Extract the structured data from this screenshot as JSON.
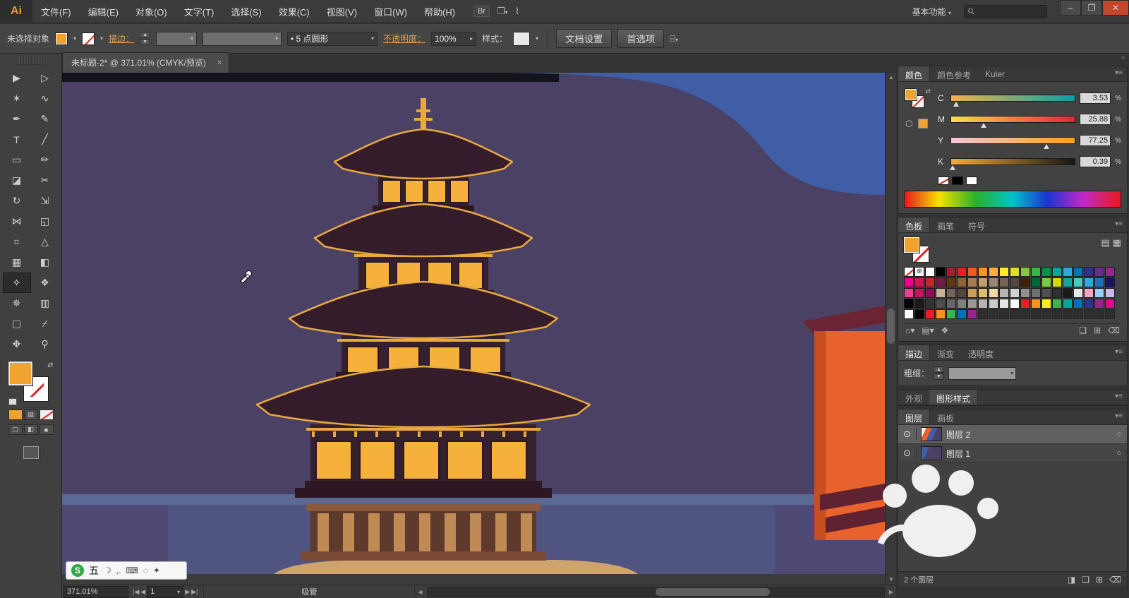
{
  "menubar": {
    "logo": "Ai",
    "items": [
      "文件(F)",
      "编辑(E)",
      "对象(O)",
      "文字(T)",
      "选择(S)",
      "效果(C)",
      "视图(V)",
      "窗口(W)",
      "帮助(H)"
    ],
    "bridge_label": "Br",
    "workspace_label": "基本功能",
    "workspace_arrow": "▾",
    "window_buttons": {
      "minimize": "–",
      "restore": "❐",
      "close": "✕"
    }
  },
  "control_bar": {
    "no_selection": "未选择对象",
    "stroke_label": "描边：",
    "brush_bullet": "•",
    "brush_value": "5 点圆形",
    "opacity_label": "不透明度：",
    "opacity_value": "100%",
    "style_label": "样式：",
    "doc_setup_label": "文档设置",
    "preferences_label": "首选项"
  },
  "document": {
    "tab_title": "未标题-2* @ 371.01% (CMYK/预览)",
    "close_glyph": "×"
  },
  "toolbar": {
    "tools": [
      {
        "name": "selection-tool",
        "glyph": "▶"
      },
      {
        "name": "direct-selection-tool",
        "glyph": "▷"
      },
      {
        "name": "magic-wand-tool",
        "glyph": "✶"
      },
      {
        "name": "lasso-tool",
        "glyph": "∿"
      },
      {
        "name": "pen-tool",
        "glyph": "✒"
      },
      {
        "name": "pencil-tool",
        "glyph": "✎"
      },
      {
        "name": "type-tool",
        "glyph": "T"
      },
      {
        "name": "line-segment-tool",
        "glyph": "╱"
      },
      {
        "name": "rectangle-tool",
        "glyph": "▭"
      },
      {
        "name": "paintbrush-tool",
        "glyph": "✏"
      },
      {
        "name": "eraser-tool",
        "glyph": "◪"
      },
      {
        "name": "scissors-tool",
        "glyph": "✂"
      },
      {
        "name": "rotate-tool",
        "glyph": "↻"
      },
      {
        "name": "scale-tool",
        "glyph": "⇲"
      },
      {
        "name": "width-tool",
        "glyph": "⋈"
      },
      {
        "name": "shape-builder-tool",
        "glyph": "◱"
      },
      {
        "name": "free-transform-tool",
        "glyph": "⌗"
      },
      {
        "name": "perspective-grid-tool",
        "glyph": "△"
      },
      {
        "name": "mesh-tool",
        "glyph": "▦"
      },
      {
        "name": "gradient-tool",
        "glyph": "◧"
      },
      {
        "name": "eyedropper-tool",
        "glyph": "✧",
        "active": true
      },
      {
        "name": "blend-tool",
        "glyph": "❖"
      },
      {
        "name": "symbol-sprayer-tool",
        "glyph": "✵"
      },
      {
        "name": "column-graph-tool",
        "glyph": "▥"
      },
      {
        "name": "artboard-tool",
        "glyph": "▢"
      },
      {
        "name": "slice-tool",
        "glyph": "⌿"
      },
      {
        "name": "hand-tool",
        "glyph": "✥"
      },
      {
        "name": "zoom-tool",
        "glyph": "⚲"
      }
    ]
  },
  "panels": {
    "color": {
      "tabs": [
        "颜色",
        "颜色参考",
        "Kuler"
      ],
      "channels": [
        {
          "label": "C",
          "value": "3.53",
          "pct": 4,
          "cls": "c"
        },
        {
          "label": "M",
          "value": "25.88",
          "pct": 26,
          "cls": "m"
        },
        {
          "label": "Y",
          "value": "77.25",
          "pct": 77,
          "cls": "y"
        },
        {
          "label": "K",
          "value": "0.39",
          "pct": 1,
          "cls": "k"
        }
      ],
      "percent_sign": "%"
    },
    "swatches": {
      "tabs": [
        "色板",
        "画笔",
        "符号"
      ],
      "grid": [
        [
          "none",
          "reg",
          "#ffffff",
          "#000000",
          "#9e1f2e",
          "#ed1c24",
          "#f15a24",
          "#f7931e",
          "#fbb03b",
          "#fcee21",
          "#d9e021",
          "#8cc63f",
          "#39b54a",
          "#009245",
          "#00a99d",
          "#29abe2",
          "#0071bc",
          "#2e3192",
          "#662d91",
          "#93278f"
        ],
        [
          "#ec008c",
          "#d4145a",
          "#c1272d",
          "#741b47",
          "#603813",
          "#8c6239",
          "#a67c52",
          "#c69c6d",
          "#998675",
          "#736357",
          "#534741",
          "#42210b",
          "#006837",
          "#7ac943",
          "#d3d800",
          "#15a79b",
          "#49c7c0",
          "#2fa8dd",
          "#1d71b8",
          "#1b1464"
        ],
        [
          "#e84393",
          "#c2185b",
          "#8e0f56",
          "#c9b299",
          "#74635a",
          "#54453e",
          "#caa05f",
          "#e0b873",
          "#efd9a7",
          "#b5b5b5",
          "#d0d0d0",
          "#909090",
          "#707070",
          "#505050",
          "#303030",
          "#181818",
          "#e8e8e8",
          "#f4a6c0",
          "#9ad0f5",
          "#c7b9e8"
        ],
        [
          "#000000",
          "#1a1a1a",
          "#333333",
          "#4d4d4d",
          "#666666",
          "#808080",
          "#999999",
          "#b3b3b3",
          "#cccccc",
          "#e6e6e6",
          "#ffffff",
          "#ed1c24",
          "#f7931e",
          "#fcee21",
          "#39b54a",
          "#00a99d",
          "#0071bc",
          "#2e3192",
          "#93278f",
          "#ec008c"
        ],
        [
          "#ffffff",
          "#000000",
          "#ed1c24",
          "#f7931e",
          "#39b54a",
          "#0071bc",
          "#93278f",
          "",
          "",
          "",
          "",
          "",
          "",
          "",
          "",
          "",
          "",
          "",
          "",
          ""
        ]
      ]
    },
    "stroke": {
      "tabs": [
        "描边",
        "渐变",
        "透明度"
      ],
      "weight_label": "粗细："
    },
    "appearance": {
      "tabs": [
        "外观",
        "图形样式"
      ]
    },
    "layers": {
      "tabs": [
        "图层",
        "画板"
      ],
      "rows": [
        {
          "name": "图层 2",
          "selected": true
        },
        {
          "name": "图层 1",
          "selected": false
        }
      ],
      "status": "2 个图层"
    }
  },
  "statusbar": {
    "zoom": "371.01%",
    "artboard": "1",
    "tool_status": "吸管"
  },
  "ime": {
    "label": "五"
  },
  "accent_colors": {
    "fill_orange": "#f0a32f",
    "canvas_purple": "#4b4164",
    "pagoda_gold": "#e9a93f",
    "mountain_blue": "#3f5ea6"
  }
}
